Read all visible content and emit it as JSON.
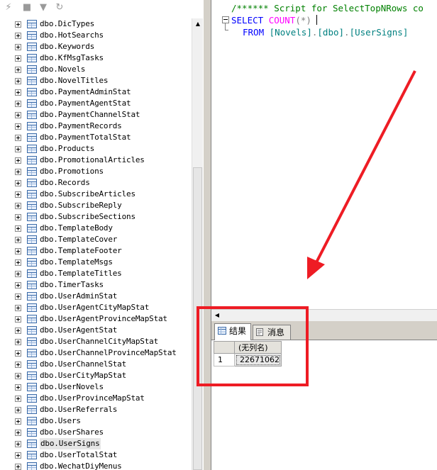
{
  "explorer": {
    "toolbar_icons": [
      "connect-icon",
      "stop-icon",
      "filter-icon",
      "refresh-icon"
    ],
    "tables": [
      "dbo.DicTypes",
      "dbo.HotSearchs",
      "dbo.Keywords",
      "dbo.KfMsgTasks",
      "dbo.Novels",
      "dbo.NovelTitles",
      "dbo.PaymentAdminStat",
      "dbo.PaymentAgentStat",
      "dbo.PaymentChannelStat",
      "dbo.PaymentRecords",
      "dbo.PaymentTotalStat",
      "dbo.Products",
      "dbo.PromotionalArticles",
      "dbo.Promotions",
      "dbo.Records",
      "dbo.SubscribeArticles",
      "dbo.SubscribeReply",
      "dbo.SubscribeSections",
      "dbo.TemplateBody",
      "dbo.TemplateCover",
      "dbo.TemplateFooter",
      "dbo.TemplateMsgs",
      "dbo.TemplateTitles",
      "dbo.TimerTasks",
      "dbo.UserAdminStat",
      "dbo.UserAgentCityMapStat",
      "dbo.UserAgentProvinceMapStat",
      "dbo.UserAgentStat",
      "dbo.UserChannelCityMapStat",
      "dbo.UserChannelProvinceMapStat",
      "dbo.UserChannelStat",
      "dbo.UserCityMapStat",
      "dbo.UserNovels",
      "dbo.UserProvinceMapStat",
      "dbo.UserReferrals",
      "dbo.Users",
      "dbo.UserShares",
      "dbo.UserSigns",
      "dbo.UserTotalStat",
      "dbo.WechatDiyMenus"
    ],
    "selected": "dbo.UserSigns"
  },
  "editor": {
    "line1": "/****** Script for SelectTopNRows co",
    "line2_kw": "SELECT",
    "line2_fn": "COUNT",
    "line2_args": "(*)",
    "line3_kw": "FROM",
    "line3_db": "[Novels]",
    "line3_dot1": ".",
    "line3_schema": "[dbo]",
    "line3_dot2": ".",
    "line3_table": "[UserSigns]"
  },
  "results": {
    "tabs": [
      {
        "label": "结果",
        "icon": "grid-icon"
      },
      {
        "label": "消息",
        "icon": "messages-icon"
      }
    ],
    "column_header": "(无列名)",
    "rows": [
      {
        "row_number": "1",
        "value": "22671062"
      }
    ]
  },
  "annotation": {
    "box_color": "#ee1c24",
    "arrow_color": "#ee1c24"
  }
}
